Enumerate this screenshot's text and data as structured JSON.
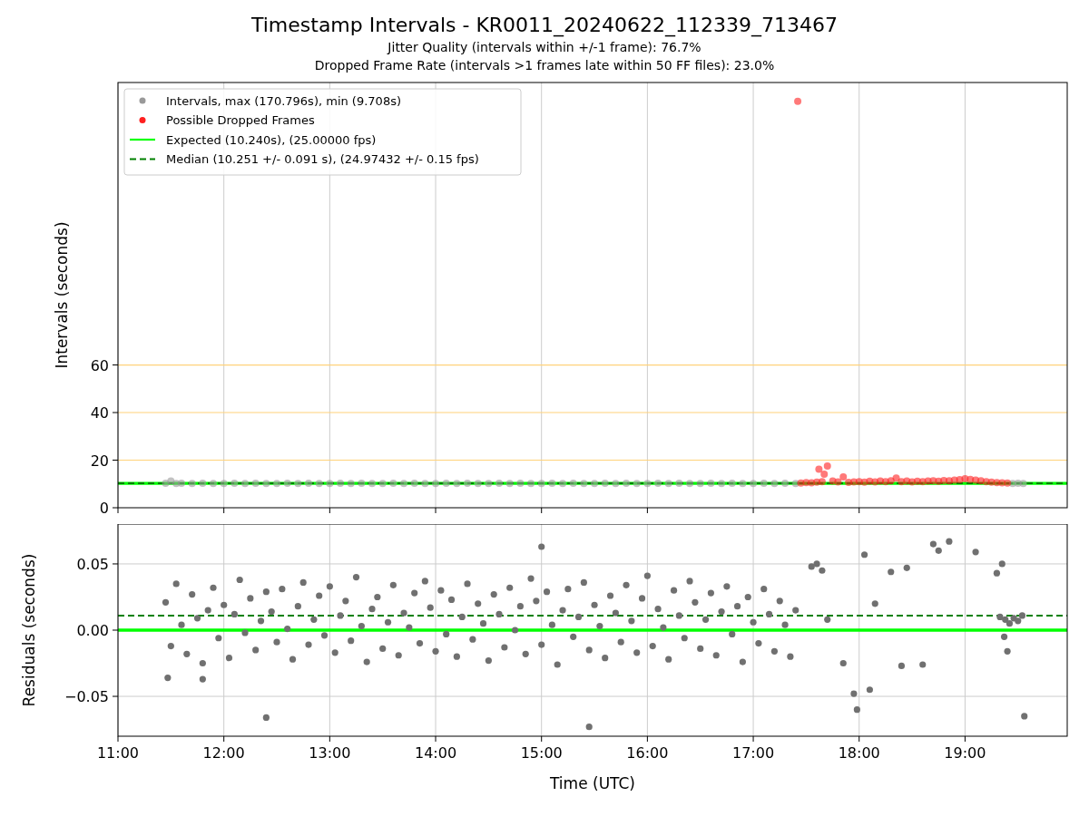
{
  "title": "Timestamp Intervals - KR0011_20240622_112339_713467",
  "subtitle_lines": [
    "Jitter Quality (intervals within +/-1 frame): 76.7%",
    "Dropped Frame Rate (intervals >1 frames late within 50 FF files): 23.0%"
  ],
  "top_panel": {
    "chart_data": {
      "type": "scatter",
      "ylabel": "Intervals (seconds)",
      "grid": "x",
      "legend": true,
      "xlim": [
        11,
        19.965
      ],
      "ylim": [
        0,
        178.7
      ],
      "yticks": [
        {
          "value": 0,
          "label": "0"
        },
        {
          "value": 20,
          "label": "20"
        },
        {
          "value": 40,
          "label": "40"
        },
        {
          "value": 60,
          "label": "60"
        }
      ],
      "ref_lines": [
        {
          "axis": "y",
          "value": 20,
          "color": "#ffd27a"
        },
        {
          "axis": "y",
          "value": 40,
          "color": "#ffd27a"
        },
        {
          "axis": "y",
          "value": 60,
          "color": "#ffd27a"
        }
      ],
      "series": [
        {
          "name": "Intervals, max (170.796s), min (9.708s)",
          "type": "scatter",
          "color": "#999999",
          "x": [
            11.45,
            11.5,
            11.55,
            11.6,
            11.7,
            11.8,
            11.9,
            12.0,
            12.1,
            12.2,
            12.3,
            12.4,
            12.5,
            12.6,
            12.7,
            12.8,
            12.9,
            13.0,
            13.1,
            13.2,
            13.3,
            13.4,
            13.5,
            13.6,
            13.7,
            13.8,
            13.9,
            14.0,
            14.1,
            14.2,
            14.3,
            14.4,
            14.5,
            14.6,
            14.7,
            14.8,
            14.9,
            15.0,
            15.1,
            15.2,
            15.3,
            15.4,
            15.5,
            15.6,
            15.7,
            15.8,
            15.9,
            16.0,
            16.1,
            16.2,
            16.3,
            16.4,
            16.5,
            16.6,
            16.7,
            16.8,
            16.9,
            17.0,
            17.1,
            17.2,
            17.3,
            17.4,
            19.45,
            19.5,
            19.55
          ],
          "values": [
            10.3,
            11.2,
            10.2,
            10.3,
            10.2,
            10.3,
            10.2,
            10.2,
            10.3,
            10.2,
            10.3,
            10.2,
            10.2,
            10.3,
            10.2,
            10.3,
            10.2,
            10.2,
            10.3,
            10.2,
            10.3,
            10.2,
            10.2,
            10.3,
            10.2,
            10.3,
            10.2,
            10.2,
            10.3,
            10.2,
            10.3,
            10.2,
            10.2,
            10.3,
            10.2,
            10.3,
            10.2,
            10.2,
            10.3,
            10.2,
            10.3,
            10.2,
            10.2,
            10.3,
            10.2,
            10.3,
            10.2,
            10.2,
            10.3,
            10.2,
            10.3,
            10.2,
            10.2,
            10.3,
            10.2,
            10.3,
            10.2,
            10.2,
            10.3,
            10.2,
            10.3,
            10.2,
            10.2,
            10.3,
            10.2
          ]
        },
        {
          "name": "Possible Dropped Frames",
          "type": "scatter",
          "color": "#ff2020",
          "x": [
            17.42,
            17.45,
            17.5,
            17.55,
            17.6,
            17.62,
            17.65,
            17.67,
            17.7,
            17.75,
            17.8,
            17.85,
            17.9,
            17.95,
            18.0,
            18.05,
            18.1,
            18.15,
            18.2,
            18.25,
            18.3,
            18.35,
            18.4,
            18.45,
            18.5,
            18.55,
            18.6,
            18.65,
            18.7,
            18.75,
            18.8,
            18.85,
            18.9,
            18.95,
            19.0,
            19.05,
            19.1,
            19.15,
            19.2,
            19.25,
            19.3,
            19.35,
            19.4
          ],
          "values": [
            170.8,
            10.4,
            10.6,
            10.5,
            10.8,
            16.2,
            11.0,
            14.1,
            17.5,
            11.2,
            10.9,
            13.0,
            10.7,
            10.9,
            11.0,
            10.8,
            11.1,
            10.9,
            11.2,
            11.0,
            11.3,
            12.5,
            11.0,
            11.2,
            10.9,
            11.1,
            11.0,
            11.2,
            11.3,
            11.1,
            11.4,
            11.3,
            11.6,
            11.8,
            12.2,
            11.9,
            11.6,
            11.3,
            11.0,
            10.8,
            10.6,
            10.5,
            10.4
          ]
        },
        {
          "name": "Expected (10.240s), (25.00000 fps)",
          "type": "line",
          "color": "#00ff00",
          "x": [
            11,
            19.965
          ],
          "values": [
            10.24,
            10.24
          ]
        },
        {
          "name": "Median (10.251 +/- 0.091 s), (24.97432 +/- 0.15 fps)",
          "type": "line",
          "line_style": "dashed",
          "color": "#008000",
          "x": [
            11,
            19.965
          ],
          "values": [
            10.251,
            10.251
          ]
        }
      ]
    }
  },
  "bottom_panel": {
    "chart_data": {
      "type": "scatter",
      "xlabel": "Time (UTC)",
      "ylabel": "Residuals (seconds)",
      "grid": "both",
      "xlim": [
        11,
        19.965
      ],
      "ylim": [
        -0.0801,
        0.0801
      ],
      "xticks": [
        {
          "value": 11,
          "label": "11:00"
        },
        {
          "value": 12,
          "label": "12:00"
        },
        {
          "value": 13,
          "label": "13:00"
        },
        {
          "value": 14,
          "label": "14:00"
        },
        {
          "value": 15,
          "label": "15:00"
        },
        {
          "value": 16,
          "label": "16:00"
        },
        {
          "value": 17,
          "label": "17:00"
        },
        {
          "value": 18,
          "label": "18:00"
        },
        {
          "value": 19,
          "label": "19:00"
        }
      ],
      "yticks": [
        {
          "value": -0.05,
          "label": "−0.05"
        },
        {
          "value": 0,
          "label": "0.00"
        },
        {
          "value": 0.05,
          "label": "0.05"
        }
      ],
      "series": [
        {
          "type": "scatter",
          "color": "#707070",
          "x": [
            11.45,
            11.47,
            11.5,
            11.55,
            11.6,
            11.65,
            11.7,
            11.75,
            11.8,
            11.8,
            11.85,
            11.9,
            11.95,
            12.0,
            12.05,
            12.1,
            12.15,
            12.2,
            12.25,
            12.3,
            12.35,
            12.4,
            12.4,
            12.45,
            12.5,
            12.55,
            12.6,
            12.65,
            12.7,
            12.75,
            12.8,
            12.85,
            12.9,
            12.95,
            13.0,
            13.05,
            13.1,
            13.15,
            13.2,
            13.25,
            13.3,
            13.35,
            13.4,
            13.45,
            13.5,
            13.55,
            13.6,
            13.65,
            13.7,
            13.75,
            13.8,
            13.85,
            13.9,
            13.95,
            14.0,
            14.05,
            14.1,
            14.15,
            14.2,
            14.25,
            14.3,
            14.35,
            14.4,
            14.45,
            14.5,
            14.55,
            14.6,
            14.65,
            14.7,
            14.75,
            14.8,
            14.85,
            14.9,
            14.95,
            15.0,
            15.0,
            15.05,
            15.1,
            15.15,
            15.2,
            15.25,
            15.3,
            15.35,
            15.4,
            15.45,
            15.45,
            15.5,
            15.55,
            15.6,
            15.65,
            15.7,
            15.75,
            15.8,
            15.85,
            15.9,
            15.95,
            16.0,
            16.05,
            16.1,
            16.15,
            16.2,
            16.25,
            16.3,
            16.35,
            16.4,
            16.45,
            16.5,
            16.55,
            16.6,
            16.65,
            16.7,
            16.75,
            16.8,
            16.85,
            16.9,
            16.95,
            17.0,
            17.05,
            17.1,
            17.15,
            17.2,
            17.25,
            17.3,
            17.35,
            17.4,
            17.55,
            17.6,
            17.65,
            17.7,
            17.85,
            17.95,
            17.98,
            18.05,
            18.1,
            18.15,
            18.3,
            18.4,
            18.45,
            18.6,
            18.7,
            18.75,
            18.85,
            19.1,
            19.3,
            19.33,
            19.35,
            19.37,
            19.38,
            19.4,
            19.42,
            19.46,
            19.5,
            19.54,
            19.56
          ],
          "values": [
            0.021,
            -0.036,
            -0.012,
            0.035,
            0.004,
            -0.018,
            0.027,
            0.009,
            -0.025,
            -0.037,
            0.015,
            0.032,
            -0.006,
            0.019,
            -0.021,
            0.012,
            0.038,
            -0.002,
            0.024,
            -0.015,
            0.007,
            0.029,
            -0.066,
            0.014,
            -0.009,
            0.031,
            0.001,
            -0.022,
            0.018,
            0.036,
            -0.011,
            0.008,
            0.026,
            -0.004,
            0.033,
            -0.017,
            0.011,
            0.022,
            -0.008,
            0.04,
            0.003,
            -0.024,
            0.016,
            0.025,
            -0.014,
            0.006,
            0.034,
            -0.019,
            0.013,
            0.002,
            0.028,
            -0.01,
            0.037,
            0.017,
            -0.016,
            0.03,
            -0.003,
            0.023,
            -0.02,
            0.01,
            0.035,
            -0.007,
            0.02,
            0.005,
            -0.023,
            0.027,
            0.012,
            -0.013,
            0.032,
            0.0,
            0.018,
            -0.018,
            0.039,
            0.022,
            -0.011,
            0.063,
            0.029,
            0.004,
            -0.026,
            0.015,
            0.031,
            -0.005,
            0.01,
            0.036,
            -0.015,
            -0.073,
            0.019,
            0.003,
            -0.021,
            0.026,
            0.013,
            -0.009,
            0.034,
            0.007,
            -0.017,
            0.024,
            0.041,
            -0.012,
            0.016,
            0.002,
            -0.022,
            0.03,
            0.011,
            -0.006,
            0.037,
            0.021,
            -0.014,
            0.008,
            0.028,
            -0.019,
            0.014,
            0.033,
            -0.003,
            0.018,
            -0.024,
            0.025,
            0.006,
            -0.01,
            0.031,
            0.012,
            -0.016,
            0.022,
            0.004,
            -0.02,
            0.015,
            0.048,
            0.05,
            0.045,
            0.008,
            -0.025,
            -0.048,
            -0.06,
            0.057,
            -0.045,
            0.02,
            0.044,
            -0.027,
            0.047,
            -0.026,
            0.065,
            0.06,
            0.067,
            0.059,
            0.043,
            0.01,
            0.05,
            -0.005,
            0.008,
            -0.016,
            0.005,
            0.009,
            0.007,
            0.011,
            -0.065
          ]
        },
        {
          "type": "line",
          "color": "#00ff00",
          "x": [
            11,
            19.965
          ],
          "values": [
            0,
            0
          ]
        },
        {
          "type": "line",
          "line_style": "dashed",
          "color": "#008000",
          "x": [
            11,
            19.965
          ],
          "values": [
            0.011,
            0.011
          ]
        }
      ]
    }
  }
}
